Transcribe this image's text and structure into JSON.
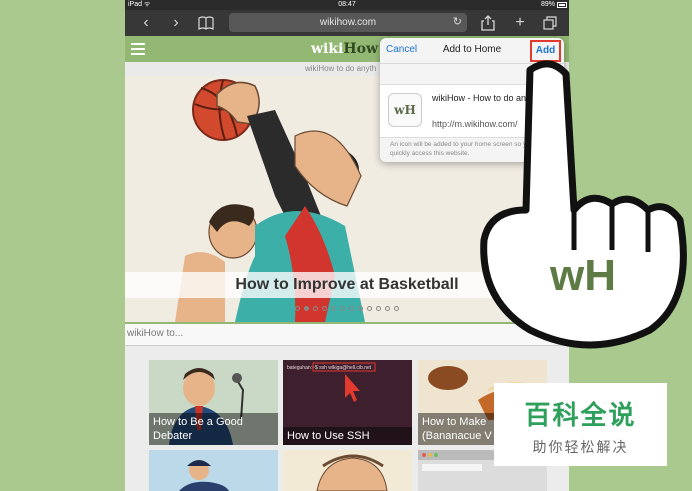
{
  "statusbar": {
    "device": "iPad ᯤ",
    "time": "08:47",
    "battery": "89%"
  },
  "toolbar": {
    "url": "wikihow.com"
  },
  "header": {
    "logo_wiki": "wiki",
    "logo_how": "How",
    "subtitle": "wikiHow to do anyth"
  },
  "hero": {
    "title": "How to Improve at Basketball",
    "dots_total": 12,
    "dots_active_index": 1
  },
  "search": {
    "placeholder": "wikiHow to..."
  },
  "tiles": [
    {
      "caption": "How to Be a Good Debater"
    },
    {
      "caption": "How to Use SSH",
      "terminal_text": "bateguhan:~$ ssh wikiga@hell.cib.net"
    },
    {
      "caption": "How to Make (Bananacue V"
    }
  ],
  "popover": {
    "cancel": "Cancel",
    "title": "Add to Home",
    "add": "Add",
    "app_name": "wikiHow - How to do anything",
    "app_url": "http://m.wikihow.com/",
    "icon_label": "wH",
    "note": "An icon will be added to your home screen so you can quickly access this website."
  },
  "hand_badge": "wH",
  "watermark": {
    "title": "百科全说",
    "subtitle": "助你轻松解决"
  },
  "colors": {
    "accent_green": "#93b874",
    "link_blue": "#1a73d8",
    "highlight_red": "#e23a2f",
    "watermark_green": "#2fa05c"
  }
}
